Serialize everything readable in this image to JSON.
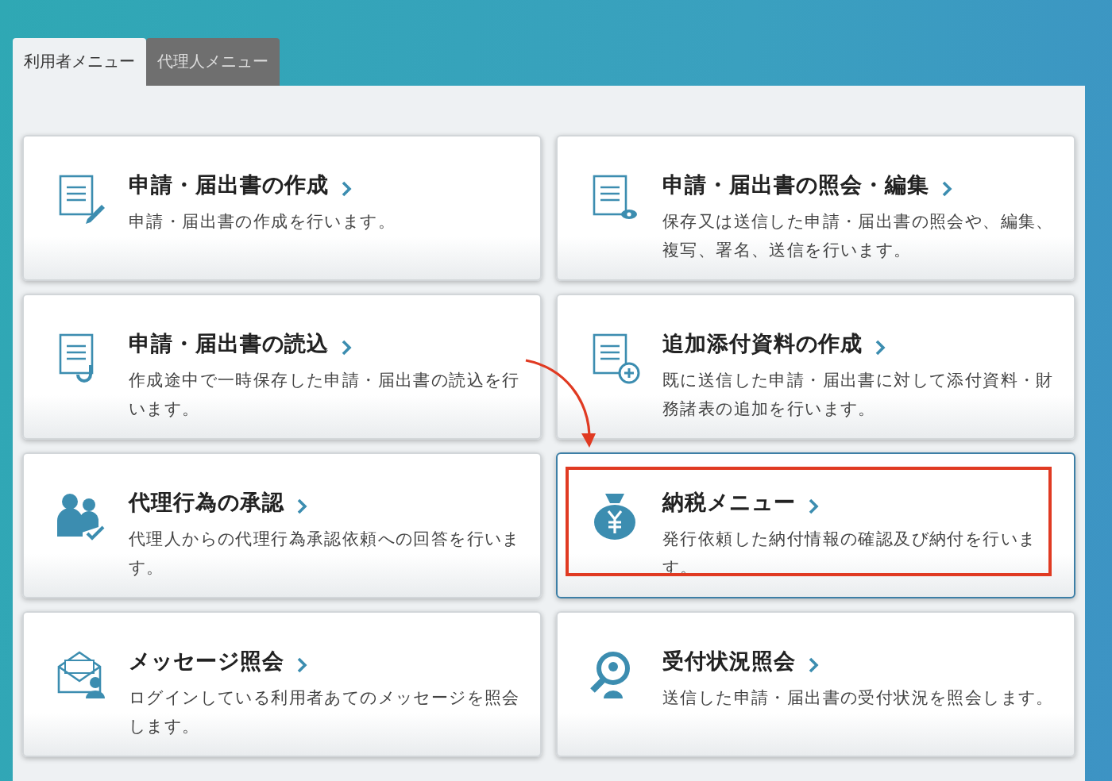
{
  "tabs": [
    {
      "label": "利用者メニュー",
      "selected": true
    },
    {
      "label": "代理人メニュー",
      "selected": false
    }
  ],
  "cards": [
    {
      "title": "申請・届出書の作成",
      "description": "申請・届出書の作成を行います。",
      "selected": false
    },
    {
      "title": "申請・届出書の照会・編集",
      "description": "保存又は送信した申請・届出書の照会や、編集、複写、署名、送信を行います。",
      "selected": false
    },
    {
      "title": "申請・届出書の読込",
      "description": "作成途中で一時保存した申請・届出書の読込を行います。",
      "selected": false
    },
    {
      "title": "追加添付資料の作成",
      "description": "既に送信した申請・届出書に対して添付資料・財務諸表の追加を行います。",
      "selected": false
    },
    {
      "title": "代理行為の承認",
      "description": "代理人からの代理行為承認依頼への回答を行います。",
      "selected": false
    },
    {
      "title": "納税メニュー",
      "description": "発行依頼した納付情報の確認及び納付を行います。",
      "selected": true
    },
    {
      "title": "メッセージ照会",
      "description": "ログインしている利用者あてのメッセージを照会します。",
      "selected": false
    },
    {
      "title": "受付状況照会",
      "description": "送信した申請・届出書の受付状況を照会します。",
      "selected": false
    }
  ]
}
